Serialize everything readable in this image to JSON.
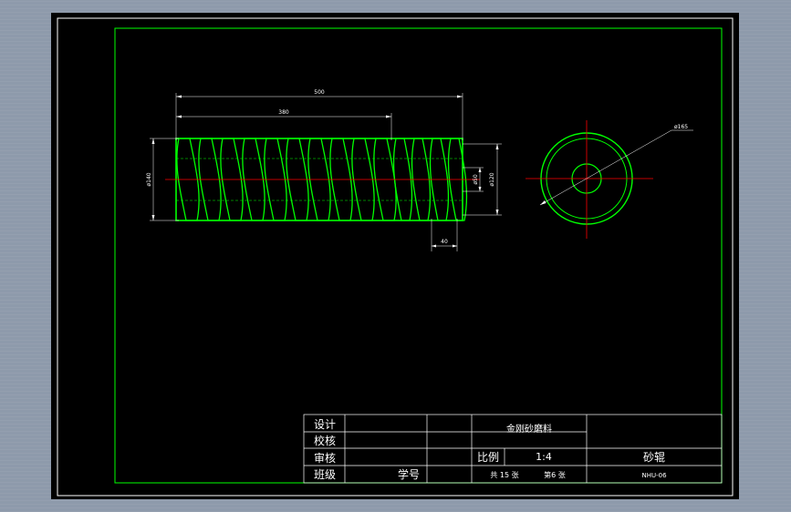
{
  "drawing": {
    "colors": {
      "background": "#000000",
      "frame": "#ffffff",
      "border": "#00ff00",
      "part": "#00ff00",
      "centerline": "#ff0000",
      "dimension": "#ffffff"
    },
    "dimensions": {
      "overall_length": "500",
      "thread_length": "380",
      "pitch_section": "40",
      "outer_diameter": "ø140",
      "bore_diameter": "ø120",
      "inner_diameter": "ø50",
      "end_view_diameter": "ø165"
    }
  },
  "title_block": {
    "row_labels": [
      "设计",
      "校核",
      "审核",
      "班级"
    ],
    "student_id_label": "学号",
    "material": "金刚砂磨料",
    "scale_label": "比例",
    "scale_value": "1:4",
    "part_name": "砂辊",
    "sheet_total": "共 15 张",
    "sheet_index": "第6 张",
    "drawing_code": "NHU-06"
  }
}
